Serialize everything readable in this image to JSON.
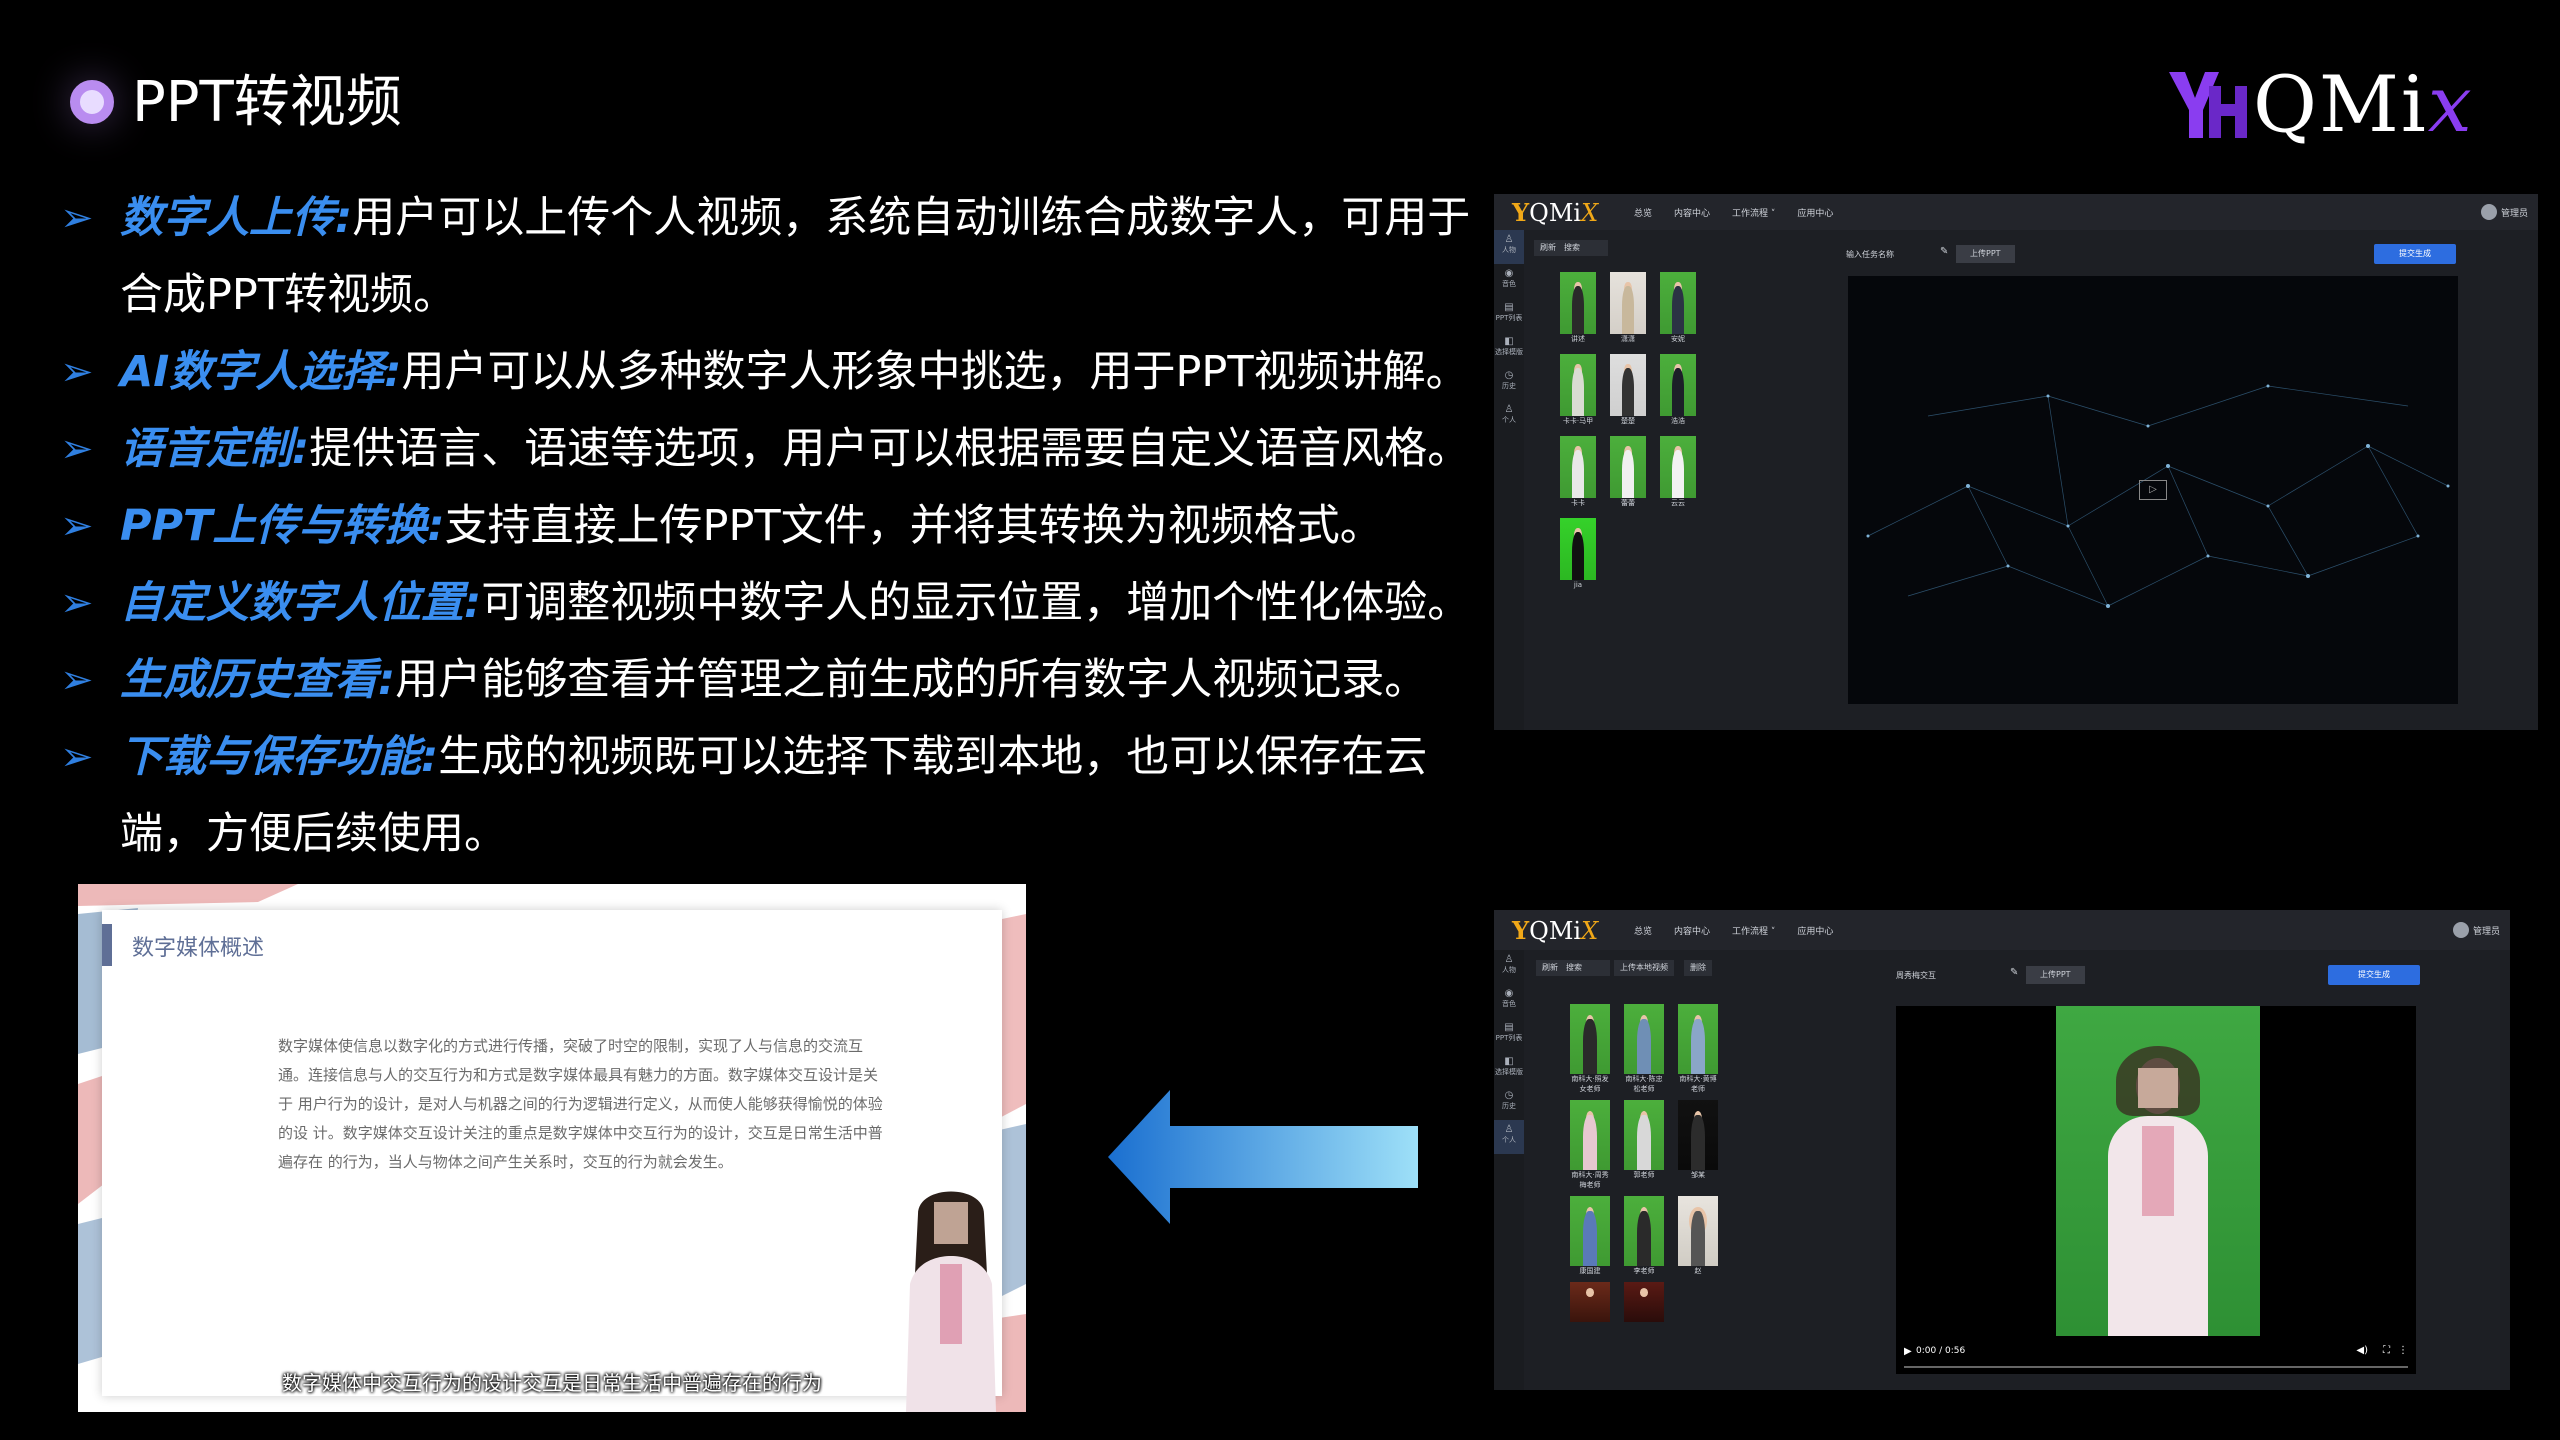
{
  "header": {
    "title": "PPT转视频",
    "logo_text": "QMi",
    "logo_x": "x"
  },
  "bullets": [
    {
      "key": "数字人上传:",
      "text": "用户可以上传个人视频，系统自动训练合成数字人，可用于合成PPT转视频。"
    },
    {
      "key": "AI数字人选择:",
      "text": "用户可以从多种数字人形象中挑选，用于PPT视频讲解。"
    },
    {
      "key": "语音定制:",
      "text": "提供语言、语速等选项，用户可以根据需要自定义语音风格。"
    },
    {
      "key": "PPT上传与转换:",
      "text": "支持直接上传PPT文件，并将其转换为视频格式。"
    },
    {
      "key": "自定义数字人位置:",
      "text": "可调整视频中数字人的显示位置，增加个性化体验。"
    },
    {
      "key": "生成历史查看:",
      "text": "用户能够查看并管理之前生成的所有数字人视频记录。"
    },
    {
      "key": "下载与保存功能:",
      "text": "生成的视频既可以选择下载到本地，也可以保存在云端，方便后续使用。"
    }
  ],
  "app1": {
    "logo": "QMi",
    "nav": [
      "总览",
      "内容中心",
      "工作流程 ˅",
      "应用中心"
    ],
    "user": "管理员",
    "side": [
      "人物",
      "音色",
      "PPT列表",
      "选择模版",
      "历史",
      "个人"
    ],
    "toolbar": [
      "刷新",
      "搜索"
    ],
    "task_label": "输入任务名称",
    "upload": "上传PPT",
    "submit": "提交生成",
    "avatars": [
      "讲述",
      "潇潇",
      "安妮",
      "卡卡·马甲",
      "楚楚",
      "浩浩",
      "卡卡",
      "蕾蕾",
      "云云",
      "jia"
    ]
  },
  "app2": {
    "logo": "QMi",
    "nav": [
      "总览",
      "内容中心",
      "工作流程 ˅",
      "应用中心"
    ],
    "user": "管理员",
    "side": [
      "人物",
      "音色",
      "PPT列表",
      "选择模版",
      "历史",
      "个人"
    ],
    "toolbar": [
      "刷新",
      "搜索",
      "上传本地视频",
      "删除"
    ],
    "task_label": "周秀梅交互",
    "upload": "上传PPT",
    "submit": "提交生成",
    "avatars": [
      "南科大·照发女老师",
      "南科大·陈忠松老师",
      "南科大·黄博老师",
      "南科大·周秀梅老师",
      "郭老师",
      "邹某",
      "康国建",
      "李老师",
      "赵",
      "",
      ""
    ],
    "video_time": "0:00 / 0:56"
  },
  "slide": {
    "title": "数字媒体概述",
    "body": "数字媒体使信息以数字化的方式进行传播，突破了时空的限制，实现了人与信息的交流互通。连接信息与人的交互行为和方式是数字媒体最具有魅力的方面。数字媒体交互设计是关于 用户行为的设计，是对人与机器之间的行为逻辑进行定义，从而使人能够获得愉悦的体验的设 计。数字媒体交互设计关注的重点是数字媒体中交互行为的设计，交互是日常生活中普遍存在 的行为，当人与物体之间产生关系时，交互的行为就会发生。",
    "subtitle": "数字媒体中交互行为的设计交互是日常生活中普遍存在的行为"
  }
}
